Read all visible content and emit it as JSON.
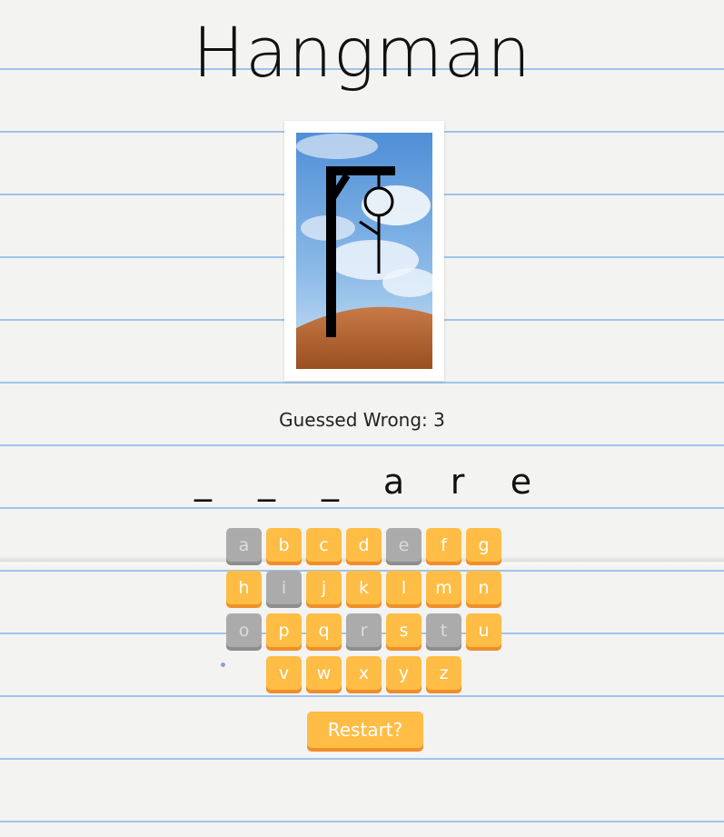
{
  "title": "Hangman",
  "status": {
    "wrong_label": "Guessed Wrong: 3",
    "wrong_count": 3
  },
  "word": [
    "_",
    "_",
    "_",
    "a",
    "r",
    "e"
  ],
  "keyboard": {
    "rows": [
      [
        {
          "k": "a",
          "used": true
        },
        {
          "k": "b",
          "used": false
        },
        {
          "k": "c",
          "used": false
        },
        {
          "k": "d",
          "used": false
        },
        {
          "k": "e",
          "used": true
        },
        {
          "k": "f",
          "used": false
        },
        {
          "k": "g",
          "used": false
        }
      ],
      [
        {
          "k": "h",
          "used": false
        },
        {
          "k": "i",
          "used": true
        },
        {
          "k": "j",
          "used": false
        },
        {
          "k": "k",
          "used": false
        },
        {
          "k": "l",
          "used": false
        },
        {
          "k": "m",
          "used": false
        },
        {
          "k": "n",
          "used": false
        }
      ],
      [
        {
          "k": "o",
          "used": true
        },
        {
          "k": "p",
          "used": false
        },
        {
          "k": "q",
          "used": false
        },
        {
          "k": "r",
          "used": true
        },
        {
          "k": "s",
          "used": false
        },
        {
          "k": "t",
          "used": true
        },
        {
          "k": "u",
          "used": false
        }
      ],
      [
        {
          "k": "v",
          "used": false
        },
        {
          "k": "w",
          "used": false
        },
        {
          "k": "x",
          "used": false
        },
        {
          "k": "y",
          "used": false
        },
        {
          "k": "z",
          "used": false
        }
      ]
    ]
  },
  "restart_label": "Restart?",
  "colors": {
    "key": "#ffbd45",
    "key_shadow": "#f08f2a",
    "key_used": "#ababab",
    "paper_line": "#9ec4ea"
  }
}
